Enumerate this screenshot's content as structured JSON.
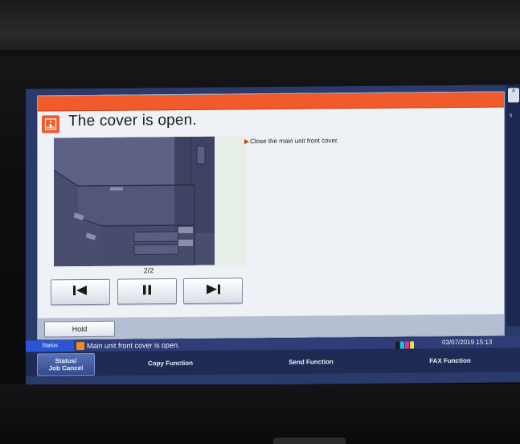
{
  "dialog": {
    "title": "The cover is open.",
    "instruction": "Close the main unit front cover.",
    "page_indicator": "2/2",
    "controls": {
      "first_icon": "skip-to-start-icon",
      "pause_icon": "pause-icon",
      "next_icon": "skip-to-end-icon"
    },
    "hold_label": "Hold"
  },
  "status_bar": {
    "tab_label": "Status",
    "message": "Main unit front cover is open.",
    "datetime": "03/07/2019  15:13"
  },
  "function_tabs": [
    {
      "label": "Status/\nJob Cancel"
    },
    {
      "label": "Copy Function"
    },
    {
      "label": "Send Function"
    },
    {
      "label": "FAX Function"
    }
  ],
  "side_panel": {
    "mini_label": "A",
    "dot_label": "5"
  },
  "colors": {
    "alert_orange": "#f15a2b",
    "screen_blue": "#2a3a6a",
    "status_tab_blue": "#2a56d6",
    "dialog_bg": "#eef1f5"
  }
}
